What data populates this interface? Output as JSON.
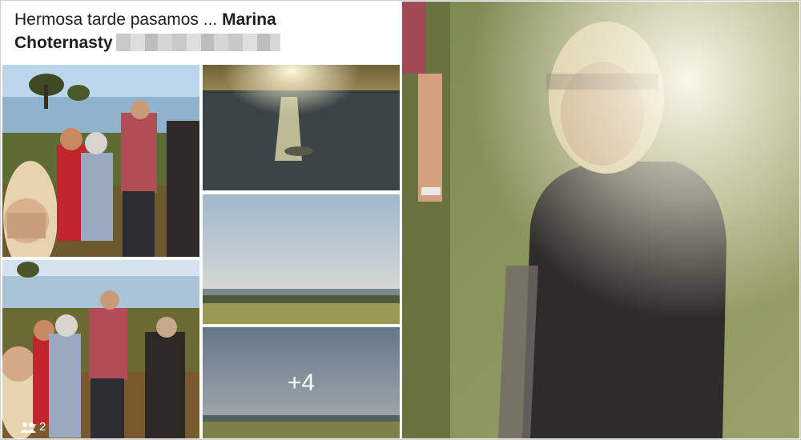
{
  "post": {
    "caption_text": "Hermosa tarde pasamos ... ",
    "author_name_line1": "Marina",
    "author_name_line2": "Choternasty"
  },
  "gallery": {
    "more_count": "+4",
    "people_tag_count": "2"
  },
  "icons": {
    "people": "people-icon"
  }
}
